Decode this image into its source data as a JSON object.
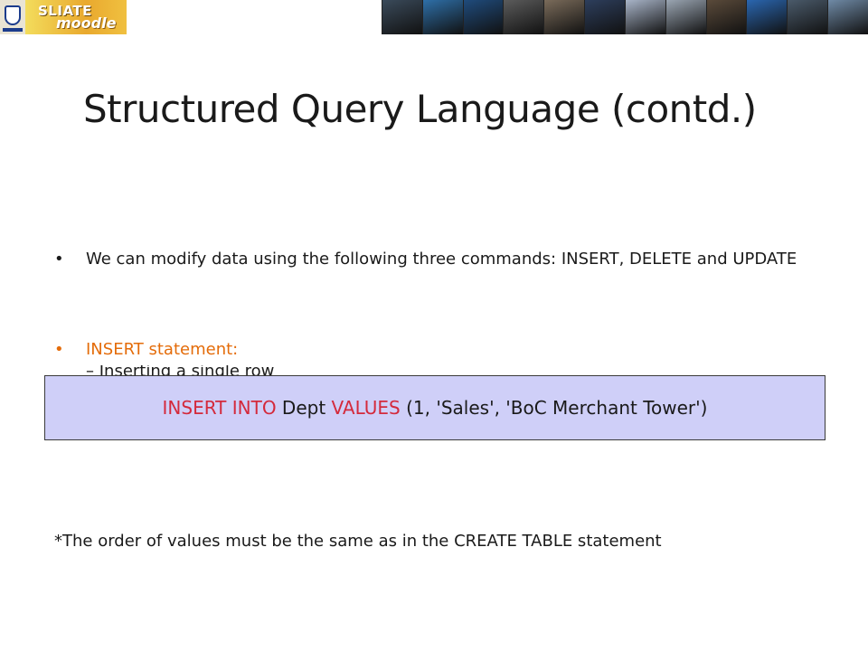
{
  "banner": {
    "logo_top": "SLIATE",
    "logo_bottom": "moodle",
    "photo_colors": [
      "#3a4a5a",
      "#2e6fa8",
      "#1f4b7c",
      "#5b5b5b",
      "#7a6b5a",
      "#2d3e5c",
      "#a8b4c8",
      "#9aa5b2",
      "#5a4a3a",
      "#2a66b0",
      "#4a5a6a",
      "#6f8aa6"
    ]
  },
  "slide": {
    "title": "Structured Query Language (contd.)",
    "bullets": [
      {
        "marker": "•",
        "text": "We can modify data using the following three commands: INSERT, DELETE and UPDATE"
      },
      {
        "marker": "•",
        "text": "INSERT statement:"
      }
    ],
    "sub_line": "– Inserting a single row",
    "code": {
      "kw1": "INSERT INTO",
      "part1": " Dept ",
      "kw2": "VALUES",
      "part2": " (1, 'Sales', 'BoC Merchant Tower')"
    },
    "note": "*The order of values must be the same as in the CREATE TABLE statement"
  },
  "colors": {
    "accent_orange": "#e46c0a",
    "keyword_red": "#d42a3c",
    "code_bg": "#cfcff8"
  }
}
